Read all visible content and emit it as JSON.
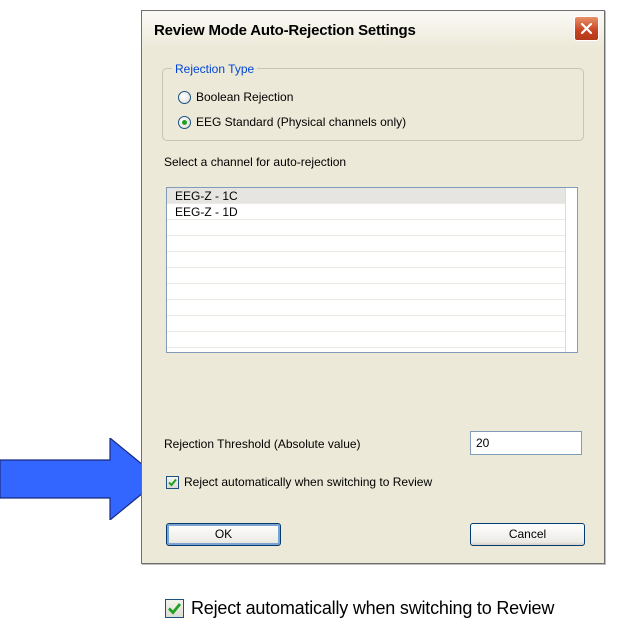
{
  "dialog": {
    "title": "Review Mode Auto-Rejection Settings",
    "close_icon": "close-icon",
    "rejection_type": {
      "legend": "Rejection Type",
      "options": [
        {
          "label": "Boolean Rejection",
          "selected": false
        },
        {
          "label": "EEG Standard (Physical channels only)",
          "selected": true
        }
      ]
    },
    "channel_select_label": "Select a channel for auto-rejection",
    "channels": [
      "EEG-Z - 1C",
      "EEG-Z - 1D"
    ],
    "selected_channel": "EEG-Z - 1C",
    "threshold": {
      "label": "Rejection Threshold (Absolute value)",
      "value": "20"
    },
    "auto_reject": {
      "label": "Reject automatically when switching to Review",
      "checked": true
    },
    "ok_label": "OK",
    "cancel_label": "Cancel"
  },
  "callout": {
    "arrow_icon": "right-arrow-icon",
    "arrow_color": "#3366ff",
    "zoom_label": "Reject automatically when switching to Review",
    "zoom_checked": true
  }
}
